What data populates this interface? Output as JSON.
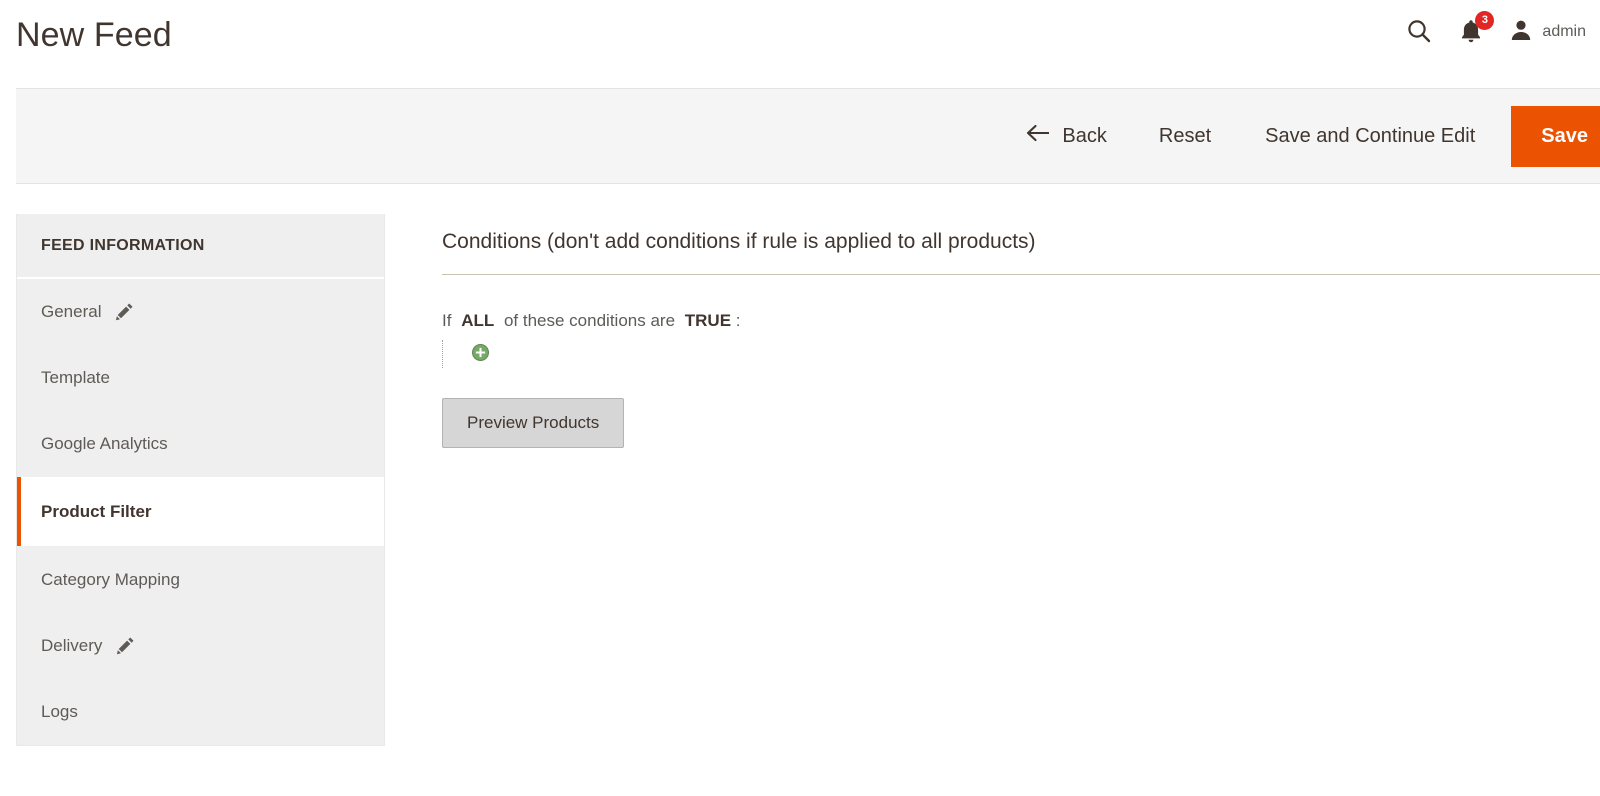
{
  "header": {
    "title": "New Feed",
    "search_icon": "search-icon",
    "notifications_icon": "bell-icon",
    "notifications_count": "3",
    "user_icon": "user-avatar-icon",
    "user_name": "admin"
  },
  "toolbar": {
    "back_icon": "arrow-left-icon",
    "back_label": "Back",
    "reset_label": "Reset",
    "save_continue_label": "Save and Continue Edit",
    "save_label": "Save",
    "primary_color": "#eb5202"
  },
  "sidebar": {
    "heading": "FEED INFORMATION",
    "items": [
      {
        "label": "General",
        "icon": "pencil-icon",
        "has_icon": true,
        "active": false
      },
      {
        "label": "Template",
        "has_icon": false,
        "active": false
      },
      {
        "label": "Google Analytics",
        "has_icon": false,
        "active": false
      },
      {
        "label": "Product Filter",
        "has_icon": false,
        "active": true
      },
      {
        "label": "Category Mapping",
        "has_icon": false,
        "active": false
      },
      {
        "label": "Delivery",
        "icon": "pencil-icon",
        "has_icon": true,
        "active": false
      },
      {
        "label": "Logs",
        "has_icon": false,
        "active": false
      }
    ]
  },
  "main": {
    "section_title": "Conditions (don't add conditions if rule is applied to all products)",
    "rule": {
      "prefix": "If",
      "aggregator": "ALL",
      "middle": "of these conditions are",
      "value": "TRUE",
      "suffix": ":"
    },
    "add_condition_icon": "add-circle-icon",
    "preview_button_label": "Preview Products"
  }
}
